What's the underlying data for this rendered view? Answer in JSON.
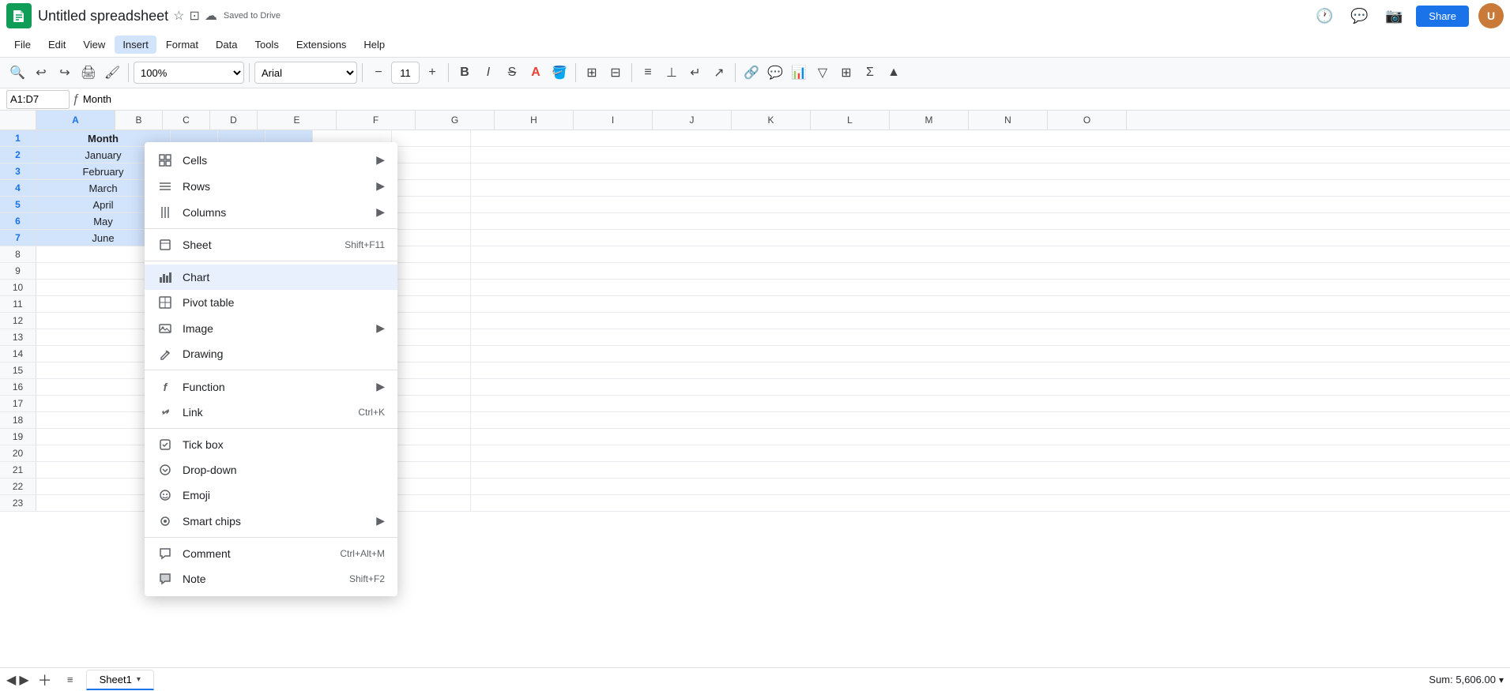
{
  "app": {
    "logo_letter": "S",
    "title": "Untitled spreadsheet",
    "saved_text": "Saved to Drive"
  },
  "header": {
    "menu_items": [
      "File",
      "Edit",
      "View",
      "Insert",
      "Format",
      "Data",
      "Tools",
      "Extensions",
      "Help"
    ],
    "active_menu": "Insert",
    "share_label": "Share"
  },
  "toolbar": {
    "font_name": "Arial",
    "font_size": "11",
    "zoom": "100%"
  },
  "formula_bar": {
    "cell_ref": "A1:D7",
    "formula": "Month"
  },
  "columns": [
    "A",
    "B",
    "C",
    "D",
    "E",
    "F",
    "G",
    "H",
    "I",
    "J",
    "K",
    "L",
    "M",
    "N",
    "O"
  ],
  "rows": [
    {
      "num": 1,
      "cells": [
        "Month",
        "",
        "",
        "",
        ""
      ]
    },
    {
      "num": 2,
      "cells": [
        "January",
        "",
        "",
        "",
        ""
      ]
    },
    {
      "num": 3,
      "cells": [
        "February",
        "",
        "",
        "",
        ""
      ]
    },
    {
      "num": 4,
      "cells": [
        "March",
        "",
        "",
        "",
        ""
      ]
    },
    {
      "num": 5,
      "cells": [
        "April",
        "",
        "",
        "",
        ""
      ]
    },
    {
      "num": 6,
      "cells": [
        "May",
        "",
        "",
        "",
        ""
      ]
    },
    {
      "num": 7,
      "cells": [
        "June",
        "",
        "",
        "",
        ""
      ]
    },
    {
      "num": 8,
      "cells": [
        "",
        "",
        "",
        "",
        ""
      ]
    },
    {
      "num": 9,
      "cells": [
        "",
        "",
        "",
        "",
        ""
      ]
    },
    {
      "num": 10,
      "cells": [
        "",
        "",
        "",
        "",
        ""
      ]
    },
    {
      "num": 11,
      "cells": [
        "",
        "",
        "",
        "",
        ""
      ]
    },
    {
      "num": 12,
      "cells": [
        "",
        "",
        "",
        "",
        ""
      ]
    },
    {
      "num": 13,
      "cells": [
        "",
        "",
        "",
        "",
        ""
      ]
    },
    {
      "num": 14,
      "cells": [
        "",
        "",
        "",
        "",
        ""
      ]
    },
    {
      "num": 15,
      "cells": [
        "",
        "",
        "",
        "",
        ""
      ]
    },
    {
      "num": 16,
      "cells": [
        "",
        "",
        "",
        "",
        ""
      ]
    },
    {
      "num": 17,
      "cells": [
        "",
        "",
        "",
        "",
        ""
      ]
    },
    {
      "num": 18,
      "cells": [
        "",
        "",
        "",
        "",
        ""
      ]
    },
    {
      "num": 19,
      "cells": [
        "",
        "",
        "",
        "",
        ""
      ]
    },
    {
      "num": 20,
      "cells": [
        "",
        "",
        "",
        "",
        ""
      ]
    },
    {
      "num": 21,
      "cells": [
        "",
        "",
        "",
        "",
        ""
      ]
    },
    {
      "num": 22,
      "cells": [
        "",
        "",
        "",
        "",
        ""
      ]
    },
    {
      "num": 23,
      "cells": [
        "",
        "",
        "",
        "",
        ""
      ]
    }
  ],
  "insert_menu": {
    "items": [
      {
        "id": "cells",
        "label": "Cells",
        "icon": "grid",
        "has_arrow": true,
        "shortcut": "",
        "divider_after": false
      },
      {
        "id": "rows",
        "label": "Rows",
        "icon": "rows",
        "has_arrow": true,
        "shortcut": "",
        "divider_after": false
      },
      {
        "id": "columns",
        "label": "Columns",
        "icon": "columns",
        "has_arrow": true,
        "shortcut": "",
        "divider_after": true
      },
      {
        "id": "sheet",
        "label": "Sheet",
        "icon": "sheet",
        "has_arrow": false,
        "shortcut": "Shift+F11",
        "divider_after": false
      },
      {
        "id": "chart",
        "label": "Chart",
        "icon": "chart",
        "has_arrow": false,
        "shortcut": "",
        "divider_after": false,
        "selected": true
      },
      {
        "id": "pivot_table",
        "label": "Pivot table",
        "icon": "pivot",
        "has_arrow": false,
        "shortcut": "",
        "divider_after": false
      },
      {
        "id": "image",
        "label": "Image",
        "icon": "image",
        "has_arrow": true,
        "shortcut": "",
        "divider_after": false
      },
      {
        "id": "drawing",
        "label": "Drawing",
        "icon": "drawing",
        "has_arrow": false,
        "shortcut": "",
        "divider_after": true
      },
      {
        "id": "function",
        "label": "Function",
        "icon": "function",
        "has_arrow": true,
        "shortcut": "",
        "divider_after": false
      },
      {
        "id": "link",
        "label": "Link",
        "icon": "link",
        "has_arrow": false,
        "shortcut": "Ctrl+K",
        "divider_after": true
      },
      {
        "id": "tick_box",
        "label": "Tick box",
        "icon": "checkbox",
        "has_arrow": false,
        "shortcut": "",
        "divider_after": false
      },
      {
        "id": "drop_down",
        "label": "Drop-down",
        "icon": "dropdown",
        "has_arrow": false,
        "shortcut": "",
        "divider_after": false
      },
      {
        "id": "emoji",
        "label": "Emoji",
        "icon": "emoji",
        "has_arrow": false,
        "shortcut": "",
        "divider_after": false
      },
      {
        "id": "smart_chips",
        "label": "Smart chips",
        "icon": "smart",
        "has_arrow": true,
        "shortcut": "",
        "divider_after": true
      },
      {
        "id": "comment",
        "label": "Comment",
        "icon": "comment",
        "has_arrow": false,
        "shortcut": "Ctrl+Alt+M",
        "divider_after": false
      },
      {
        "id": "note",
        "label": "Note",
        "icon": "note",
        "has_arrow": false,
        "shortcut": "Shift+F2",
        "divider_after": false
      }
    ]
  },
  "bottom_bar": {
    "sheet_name": "Sheet1",
    "sum_label": "Sum: 5,606.00"
  },
  "icons": {
    "cells": "⊞",
    "rows": "≡",
    "columns": "|||",
    "sheet": "☰",
    "chart": "📊",
    "pivot": "⊟",
    "image": "🖼",
    "drawing": "✏",
    "function": "f",
    "link": "🔗",
    "checkbox": "☑",
    "dropdown": "⊙",
    "emoji": "☺",
    "smart": "◈",
    "comment": "💬",
    "note": "📝"
  }
}
